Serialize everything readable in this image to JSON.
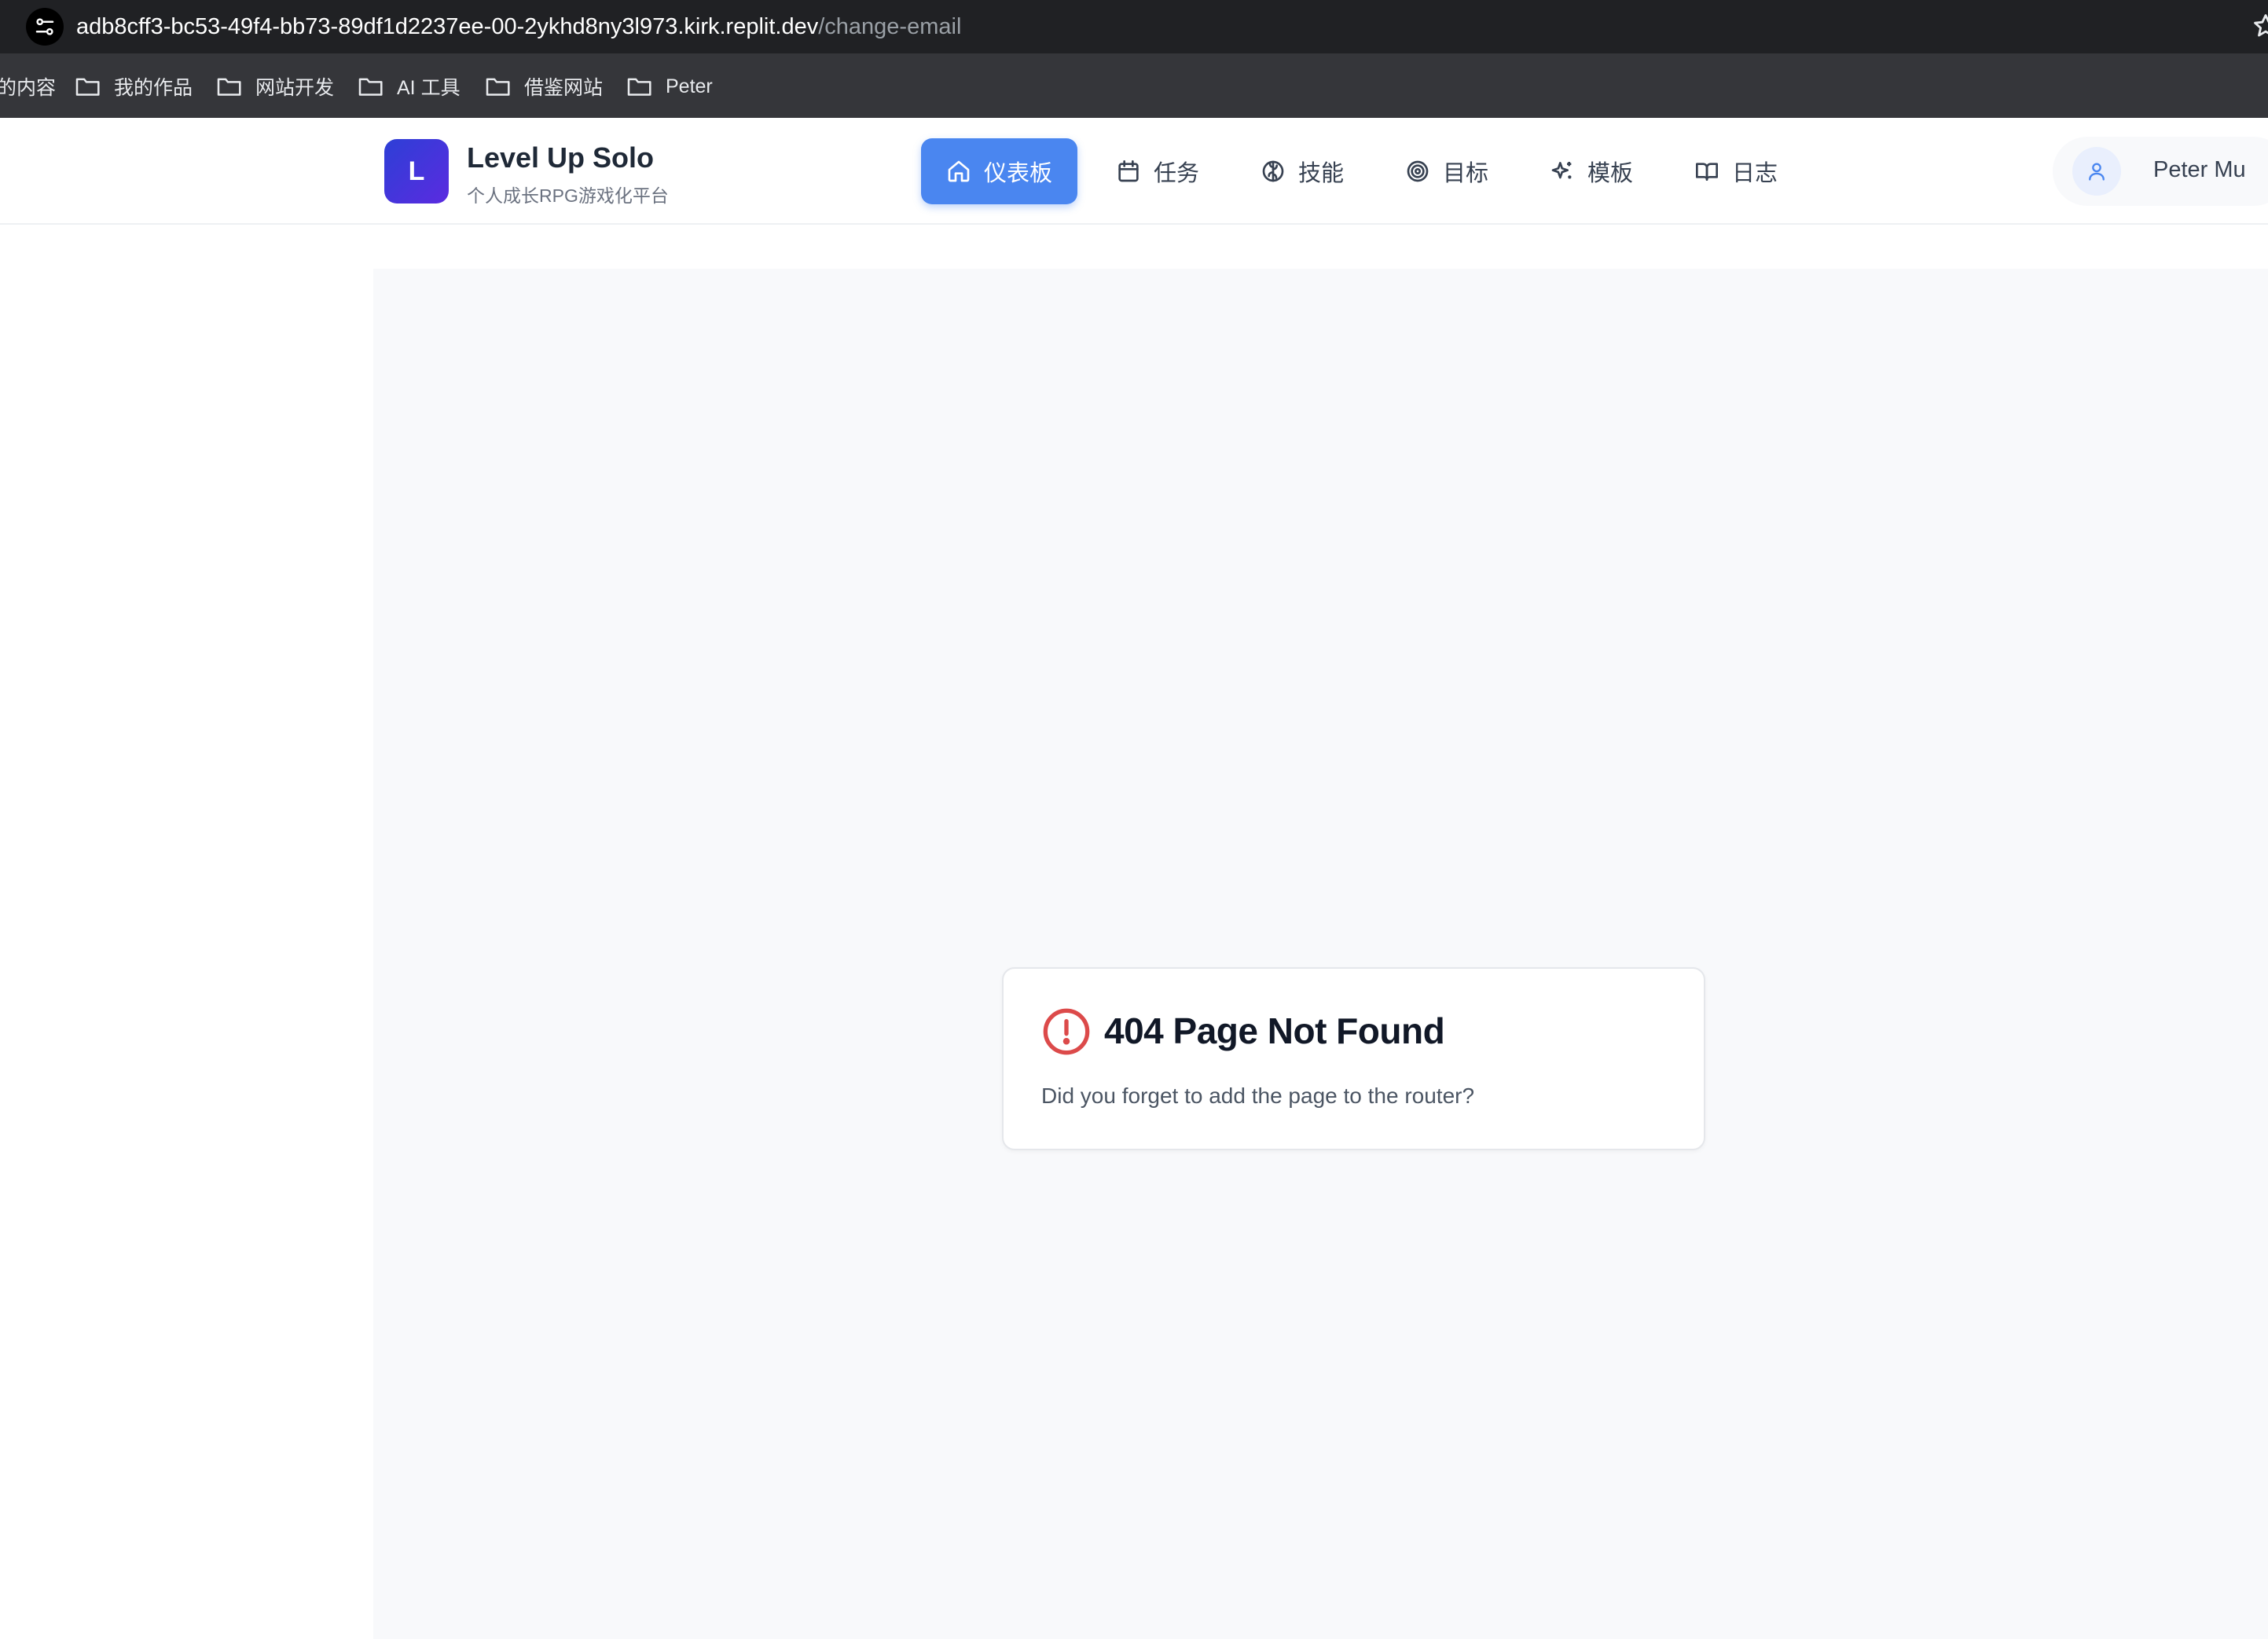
{
  "browser": {
    "url_host": "adb8cff3-bc53-49f4-bb73-89df1d2237ee-00-2ykhd8ny3l973.kirk.replit.dev",
    "url_path": "/change-email",
    "site_info_icon": "tune-icon",
    "bookmark_icon": "star-icon"
  },
  "bookmarks": [
    {
      "label": "的内容",
      "icon": "none"
    },
    {
      "label": "我的作品",
      "icon": "folder-icon"
    },
    {
      "label": "网站开发",
      "icon": "folder-icon"
    },
    {
      "label": "AI 工具",
      "icon": "folder-icon"
    },
    {
      "label": "借鉴网站",
      "icon": "folder-icon"
    },
    {
      "label": "Peter",
      "icon": "folder-icon"
    }
  ],
  "app": {
    "logo_letter": "L",
    "title": "Level Up Solo",
    "subtitle": "个人成长RPG游戏化平台",
    "brand_color": "#4a86f0"
  },
  "nav": [
    {
      "label": "仪表板",
      "icon": "home-icon",
      "active": true
    },
    {
      "label": "任务",
      "icon": "calendar-icon",
      "active": false
    },
    {
      "label": "技能",
      "icon": "brain-icon",
      "active": false
    },
    {
      "label": "目标",
      "icon": "target-icon",
      "active": false
    },
    {
      "label": "模板",
      "icon": "sparkles-icon",
      "active": false
    },
    {
      "label": "日志",
      "icon": "book-open-icon",
      "active": false
    }
  ],
  "user": {
    "name": "Peter Mu",
    "icon": "user-icon"
  },
  "error_card": {
    "icon": "alert-circle-icon",
    "icon_color": "#dc4a4a",
    "title": "404 Page Not Found",
    "message": "Did you forget to add the page to the router?"
  }
}
